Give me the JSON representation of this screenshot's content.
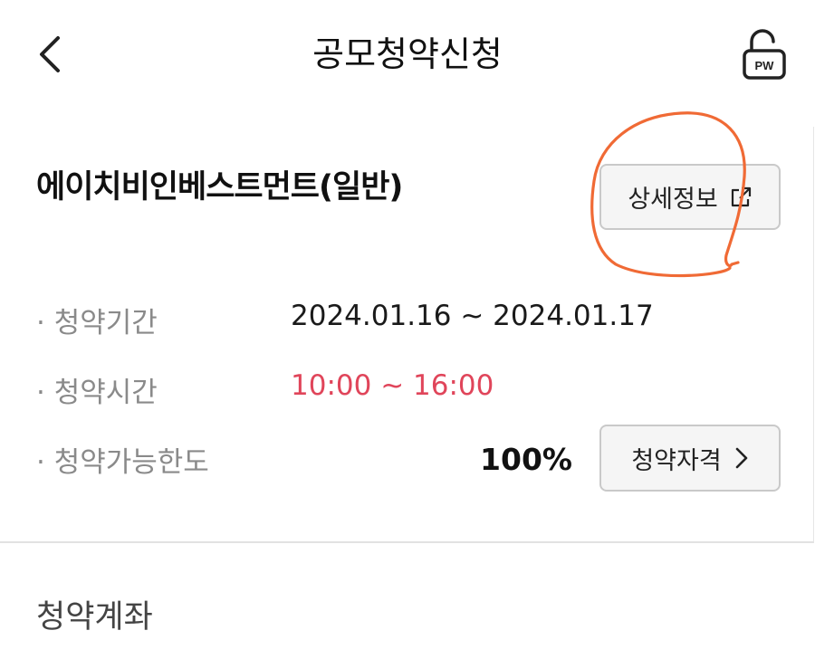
{
  "header": {
    "title": "공모청약신청",
    "back_icon": "chevron-left-icon",
    "pw_icon": "padlock-icon",
    "pw_label": "PW"
  },
  "product": {
    "name": "에이치비인베스트먼트(일반)",
    "detail_button_label": "상세정보",
    "detail_icon": "external-link-icon"
  },
  "rows": [
    {
      "label": "· 청약기간",
      "value": "2024.01.16 ~ 2024.01.17"
    },
    {
      "label": "· 청약시간",
      "value": "10:00 ~ 16:00"
    },
    {
      "label": "· 청약가능한도",
      "value": "100%"
    }
  ],
  "qualification_button_label": "청약자격",
  "qualification_icon": "chevron-right-icon",
  "account_section_title": "청약계좌",
  "colors": {
    "time_highlight": "#e0455a",
    "annotation": "#f06a35"
  }
}
